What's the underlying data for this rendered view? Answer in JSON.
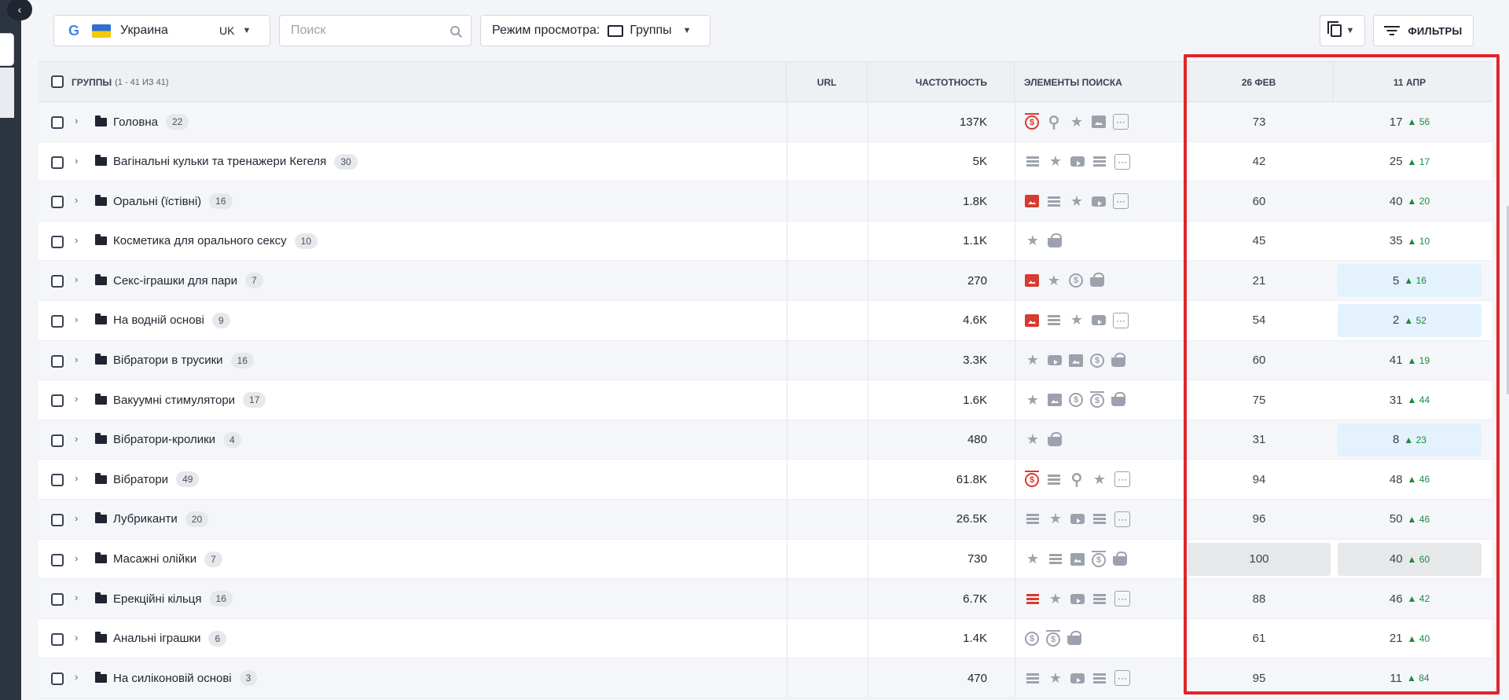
{
  "toolbar": {
    "search_engine_icon": "google-logo",
    "flag_icon": "ukraine-flag",
    "country": "Украина",
    "language": "UK",
    "search_placeholder": "Поиск",
    "view_mode_label": "Режим просмотра:",
    "view_mode_value": "Группы",
    "filters_label": "ФИЛЬТРЫ"
  },
  "table": {
    "headers": {
      "groups": "ГРУППЫ",
      "groups_count": "(1 - 41 ИЗ 41)",
      "url": "URL",
      "frequency": "ЧАСТОТНОСТЬ",
      "serp_features": "ЭЛЕМЕНТЫ ПОИСКА",
      "date1": "26 ФЕВ",
      "date2": "11 АПР"
    },
    "rows": [
      {
        "name": "Головна",
        "count": "22",
        "freq": "137K",
        "serp": [
          "coinbar-red",
          "pin",
          "star",
          "image",
          "more"
        ],
        "d1": "73",
        "d2": "17",
        "d2_change": "56",
        "hl": ""
      },
      {
        "name": "Вагінальні кульки та тренажери Кегеля",
        "count": "30",
        "freq": "5K",
        "serp": [
          "lines",
          "star",
          "video",
          "lines",
          "more"
        ],
        "d1": "42",
        "d2": "25",
        "d2_change": "17",
        "hl": ""
      },
      {
        "name": "Оральні (їстівні)",
        "count": "16",
        "freq": "1.8K",
        "serp": [
          "image-red",
          "lines",
          "star",
          "video",
          "more"
        ],
        "d1": "60",
        "d2": "40",
        "d2_change": "20",
        "hl": ""
      },
      {
        "name": "Косметика для орального сексу",
        "count": "10",
        "freq": "1.1K",
        "serp": [
          "star",
          "basket"
        ],
        "d1": "45",
        "d2": "35",
        "d2_change": "10",
        "hl": ""
      },
      {
        "name": "Секс-іграшки для пари",
        "count": "7",
        "freq": "270",
        "serp": [
          "image-red",
          "star",
          "coin",
          "basket"
        ],
        "d1": "21",
        "d2": "5",
        "d2_change": "16",
        "hl": "blue"
      },
      {
        "name": "На водній основі",
        "count": "9",
        "freq": "4.6K",
        "serp": [
          "image-red",
          "lines",
          "star",
          "video",
          "more"
        ],
        "d1": "54",
        "d2": "2",
        "d2_change": "52",
        "hl": "blue"
      },
      {
        "name": "Вібратори в трусики",
        "count": "16",
        "freq": "3.3K",
        "serp": [
          "star",
          "video",
          "image",
          "coin",
          "basket"
        ],
        "d1": "60",
        "d2": "41",
        "d2_change": "19",
        "hl": ""
      },
      {
        "name": "Вакуумні стимулятори",
        "count": "17",
        "freq": "1.6K",
        "serp": [
          "star",
          "image",
          "coin",
          "coinbar",
          "basket"
        ],
        "d1": "75",
        "d2": "31",
        "d2_change": "44",
        "hl": ""
      },
      {
        "name": "Вібратори-кролики",
        "count": "4",
        "freq": "480",
        "serp": [
          "star",
          "basket"
        ],
        "d1": "31",
        "d2": "8",
        "d2_change": "23",
        "hl": "blue"
      },
      {
        "name": "Вібратори",
        "count": "49",
        "freq": "61.8K",
        "serp": [
          "coinbar-red",
          "lines",
          "pin",
          "star",
          "more"
        ],
        "d1": "94",
        "d2": "48",
        "d2_change": "46",
        "hl": ""
      },
      {
        "name": "Лубриканти",
        "count": "20",
        "freq": "26.5K",
        "serp": [
          "lines",
          "star",
          "video",
          "lines",
          "more"
        ],
        "d1": "96",
        "d2": "50",
        "d2_change": "46",
        "hl": ""
      },
      {
        "name": "Масажні олійки",
        "count": "7",
        "freq": "730",
        "serp": [
          "star",
          "lines",
          "image",
          "coinbar",
          "basket"
        ],
        "d1": "100",
        "d2": "40",
        "d2_change": "60",
        "hl": "gray"
      },
      {
        "name": "Ерекційні кільця",
        "count": "16",
        "freq": "6.7K",
        "serp": [
          "lines-red",
          "star",
          "video",
          "lines",
          "more"
        ],
        "d1": "88",
        "d2": "46",
        "d2_change": "42",
        "hl": ""
      },
      {
        "name": "Анальні іграшки",
        "count": "6",
        "freq": "1.4K",
        "serp": [
          "coin",
          "coinbar",
          "basket"
        ],
        "d1": "61",
        "d2": "21",
        "d2_change": "40",
        "hl": ""
      },
      {
        "name": "На силіконовій основі",
        "count": "3",
        "freq": "470",
        "serp": [
          "lines",
          "star",
          "video",
          "lines",
          "more"
        ],
        "d1": "95",
        "d2": "11",
        "d2_change": "84",
        "hl": ""
      }
    ]
  },
  "colors": {
    "highlight_frame": "#e0252b",
    "positive_change": "#1e8a3e",
    "highlight_blue": "#e3f2fc",
    "highlight_gray": "#e7e8ea",
    "serp_red": "#d63c2f"
  }
}
